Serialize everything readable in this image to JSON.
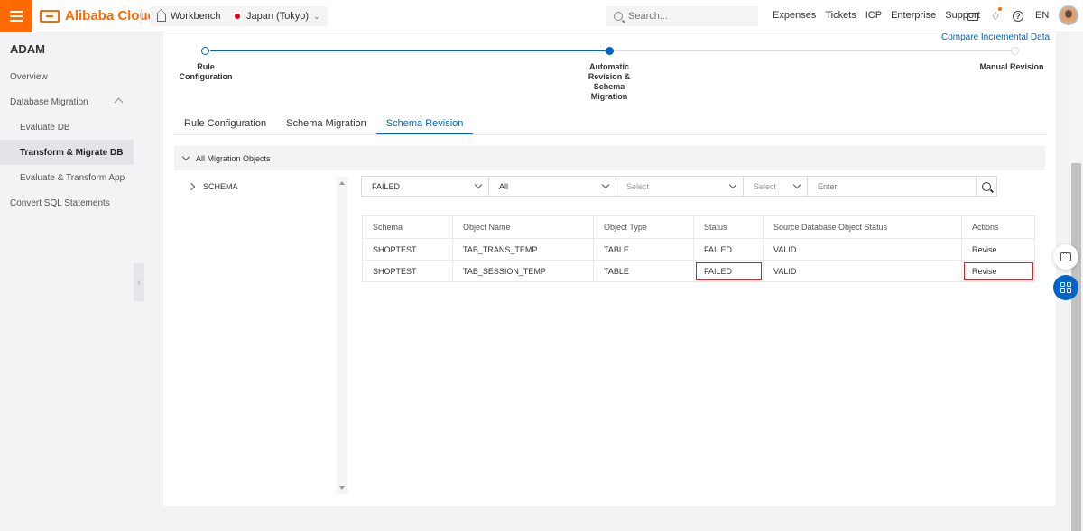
{
  "topbar": {
    "brand": "Alibaba Cloud",
    "workbench": "Workbench",
    "region": "Japan (Tokyo)",
    "search_placeholder": "Search...",
    "links": [
      "Expenses",
      "Tickets",
      "ICP",
      "Enterprise",
      "Support"
    ],
    "language": "EN"
  },
  "sidebar": {
    "title": "ADAM",
    "items": [
      {
        "label": "Overview"
      },
      {
        "label": "Database Migration"
      },
      {
        "label": "Evaluate DB"
      },
      {
        "label": "Transform & Migrate DB"
      },
      {
        "label": "Evaluate & Transform App"
      },
      {
        "label": "Convert SQL Statements"
      }
    ]
  },
  "main": {
    "compare_link": "Compare Incremental Data",
    "steps": [
      {
        "label": "Rule\nConfiguration",
        "state": "done"
      },
      {
        "label": "Automatic\nRevision &\nSchema\nMigration",
        "state": "current"
      },
      {
        "label": "Manual Revision",
        "state": "pending"
      }
    ],
    "tabs": [
      "Rule Configuration",
      "Schema Migration",
      "Schema Revision"
    ],
    "active_tab": "Schema Revision",
    "tree": {
      "root": "All Migration Objects",
      "children": [
        "SCHEMA"
      ]
    },
    "filters": {
      "status": "FAILED",
      "type": "All",
      "select1": "Select",
      "select2": "Select",
      "search_placeholder": "Enter"
    },
    "table": {
      "headers": [
        "Schema",
        "Object Name",
        "Object Type",
        "Status",
        "Source Database Object Status",
        "Actions"
      ],
      "rows": [
        [
          "SHOPTEST",
          "TAB_TRANS_TEMP",
          "TABLE",
          "FAILED",
          "VALID",
          "Revise"
        ],
        [
          "SHOPTEST",
          "TAB_SESSION_TEMP",
          "TABLE",
          "FAILED",
          "VALID",
          "Revise"
        ]
      ]
    }
  },
  "colors": {
    "brand": "#ff6a00",
    "accent": "#0064c8",
    "highlight": "#e02020"
  }
}
